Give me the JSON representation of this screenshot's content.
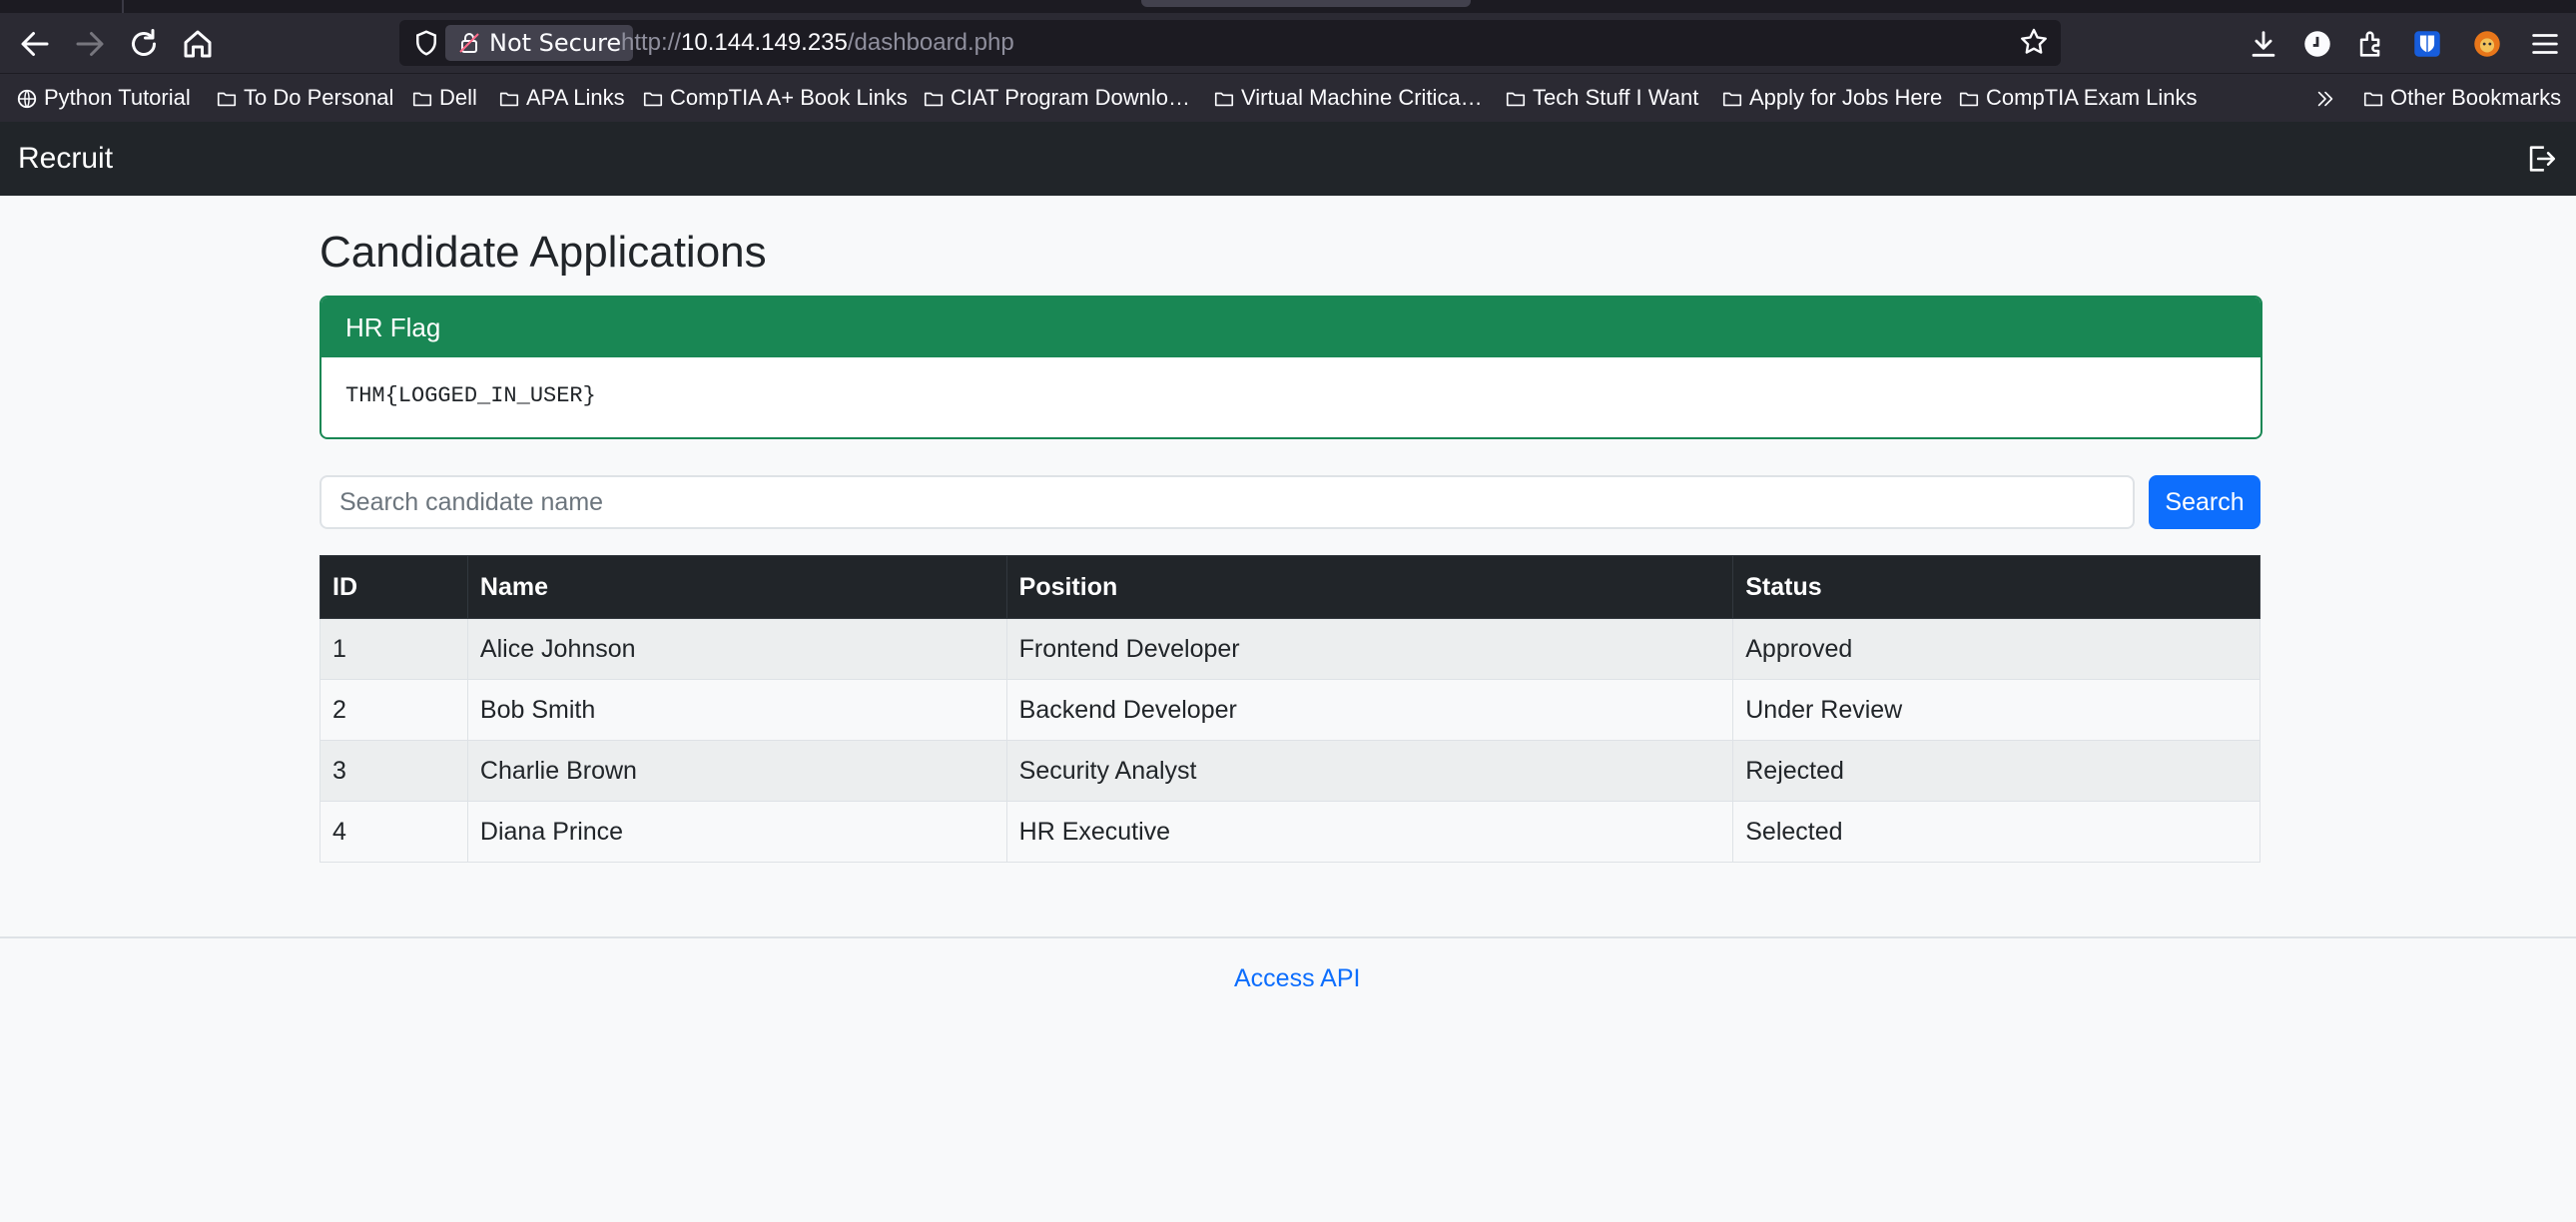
{
  "browser": {
    "security_label": "Not Secure",
    "url_prefix": "http://",
    "url_host": "10.144.149.235",
    "url_path": "/dashboard.php",
    "bookmarks": [
      {
        "label": "Python Tutorial",
        "icon": "globe-icon"
      },
      {
        "label": "To Do Personal",
        "icon": "folder-icon"
      },
      {
        "label": "Dell",
        "icon": "folder-icon"
      },
      {
        "label": "APA Links",
        "icon": "folder-icon"
      },
      {
        "label": "CompTIA A+ Book Links",
        "icon": "folder-icon"
      },
      {
        "label": "CIAT Program Downlo…",
        "icon": "folder-icon"
      },
      {
        "label": "Virtual Machine Critica…",
        "icon": "folder-icon"
      },
      {
        "label": "Tech Stuff I Want",
        "icon": "folder-icon"
      },
      {
        "label": "Apply for Jobs Here",
        "icon": "folder-icon"
      },
      {
        "label": "CompTIA Exam Links",
        "icon": "folder-icon"
      }
    ],
    "other_bookmarks": "Other Bookmarks"
  },
  "navbar": {
    "brand": "Recruit"
  },
  "main": {
    "title": "Candidate Applications",
    "flag_card": {
      "header": "HR Flag",
      "body": "THM{LOGGED_IN_USER}"
    },
    "search": {
      "placeholder": "Search candidate name",
      "button": "Search"
    },
    "table": {
      "headers": [
        "ID",
        "Name",
        "Position",
        "Status"
      ],
      "rows": [
        [
          "1",
          "Alice Johnson",
          "Frontend Developer",
          "Approved"
        ],
        [
          "2",
          "Bob Smith",
          "Backend Developer",
          "Under Review"
        ],
        [
          "3",
          "Charlie Brown",
          "Security Analyst",
          "Rejected"
        ],
        [
          "4",
          "Diana Prince",
          "HR Executive",
          "Selected"
        ]
      ]
    }
  },
  "footer": {
    "link": "Access API"
  },
  "colors": {
    "success": "#198754",
    "primary": "#0d6efd",
    "dark": "#212529"
  }
}
